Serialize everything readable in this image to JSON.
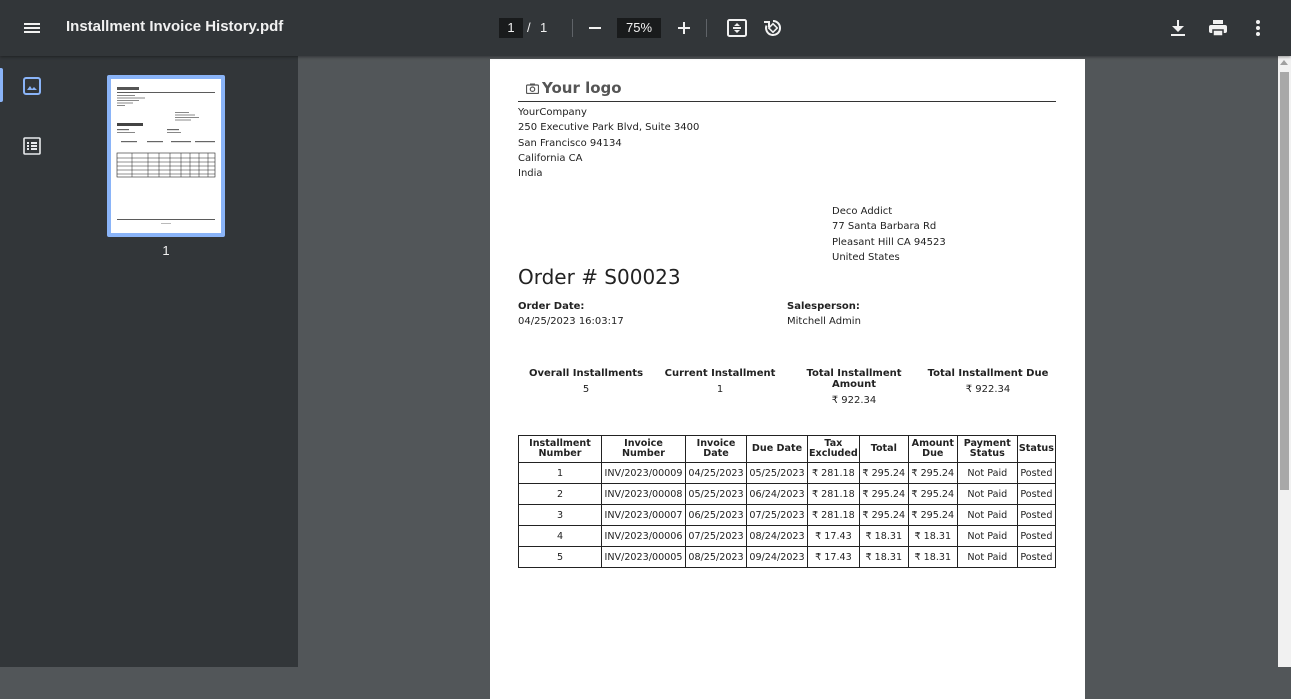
{
  "toolbar": {
    "title": "Installment Invoice History.pdf",
    "page_current": "1",
    "page_sep": "/",
    "page_total": "1",
    "zoom": "75%"
  },
  "sidebar": {
    "thumbnail_number": "1"
  },
  "document": {
    "logo": "Your logo",
    "company": [
      "YourCompany",
      "250 Executive Park Blvd, Suite 3400",
      "San Francisco 94134",
      "California CA",
      "India"
    ],
    "customer": [
      "Deco Addict",
      "77 Santa Barbara Rd",
      "Pleasant Hill CA 94523",
      "United States"
    ],
    "order_title": "Order # S00023",
    "order_date_label": "Order Date:",
    "order_date": "04/25/2023 16:03:17",
    "salesperson_label": "Salesperson:",
    "salesperson": "Mitchell Admin",
    "summary": [
      {
        "label": "Overall Installments",
        "value": "5"
      },
      {
        "label": "Current Installment",
        "value": "1"
      },
      {
        "label": "Total Installment Amount",
        "value": "₹ 922.34"
      },
      {
        "label": "Total Installment Due",
        "value": "₹ 922.34"
      }
    ],
    "table": {
      "headers": [
        "Installment Number",
        "Invoice Number",
        "Invoice Date",
        "Due Date",
        "Tax Excluded",
        "Total",
        "Amount Due",
        "Payment Status",
        "Status"
      ],
      "rows": [
        [
          "1",
          "INV/2023/00009",
          "04/25/2023",
          "05/25/2023",
          "₹ 281.18",
          "₹ 295.24",
          "₹ 295.24",
          "Not Paid",
          "Posted"
        ],
        [
          "2",
          "INV/2023/00008",
          "05/25/2023",
          "06/24/2023",
          "₹ 281.18",
          "₹ 295.24",
          "₹ 295.24",
          "Not Paid",
          "Posted"
        ],
        [
          "3",
          "INV/2023/00007",
          "06/25/2023",
          "07/25/2023",
          "₹ 281.18",
          "₹ 295.24",
          "₹ 295.24",
          "Not Paid",
          "Posted"
        ],
        [
          "4",
          "INV/2023/00006",
          "07/25/2023",
          "08/24/2023",
          "₹ 17.43",
          "₹ 18.31",
          "₹ 18.31",
          "Not Paid",
          "Posted"
        ],
        [
          "5",
          "INV/2023/00005",
          "08/25/2023",
          "09/24/2023",
          "₹ 17.43",
          "₹ 18.31",
          "₹ 18.31",
          "Not Paid",
          "Posted"
        ]
      ]
    }
  }
}
